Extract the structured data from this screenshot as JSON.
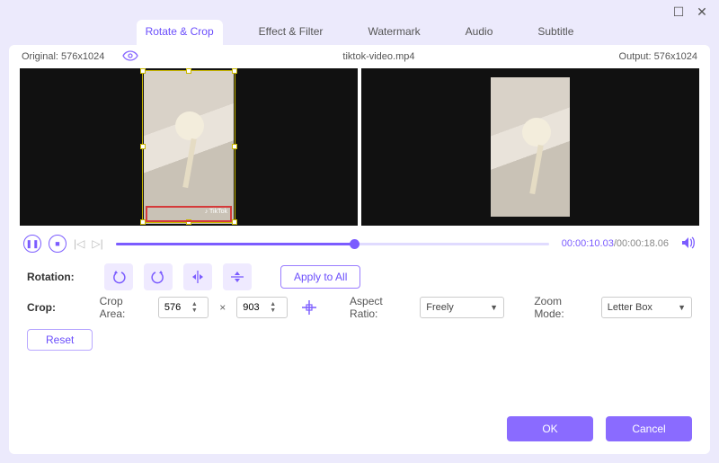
{
  "window": {
    "maximize_icon": "☐",
    "close_icon": "✕"
  },
  "tabs": {
    "rotate_crop": "Rotate & Crop",
    "effect_filter": "Effect & Filter",
    "watermark": "Watermark",
    "audio": "Audio",
    "subtitle": "Subtitle"
  },
  "info": {
    "original_label": "Original: 576x1024",
    "filename": "tiktok-video.mp4",
    "output_label": "Output: 576x1024"
  },
  "watermark_text": "♪ TikTok",
  "transport": {
    "current_time": "00:00:10.03",
    "duration": "/00:00:18.06"
  },
  "rotation": {
    "label": "Rotation:",
    "apply_all": "Apply to All"
  },
  "crop": {
    "label": "Crop:",
    "area_label": "Crop Area:",
    "width": "576",
    "height": "903",
    "aspect_label": "Aspect Ratio:",
    "aspect_value": "Freely",
    "zoom_label": "Zoom Mode:",
    "zoom_value": "Letter Box",
    "reset": "Reset"
  },
  "footer": {
    "ok": "OK",
    "cancel": "Cancel"
  }
}
